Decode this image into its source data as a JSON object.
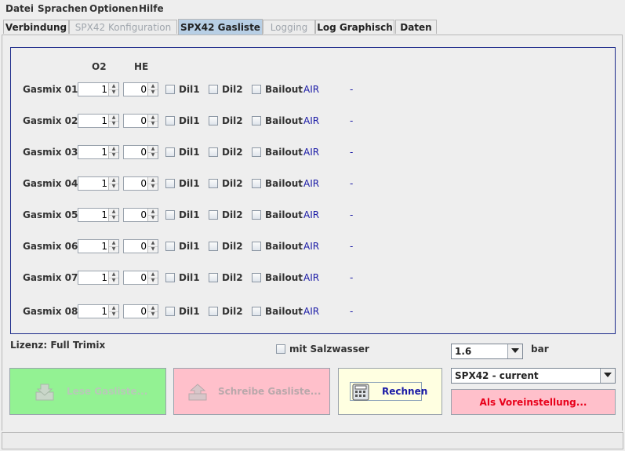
{
  "menu": [
    "Datei",
    "Sprachen",
    "Optionen",
    "Hilfe"
  ],
  "tabs": [
    {
      "label": "Verbindung",
      "state": "normal"
    },
    {
      "label": "SPX42 Konfiguration",
      "state": "disabled"
    },
    {
      "label": "SPX42 Gasliste",
      "state": "active"
    },
    {
      "label": "Logging",
      "state": "disabled"
    },
    {
      "label": "Log Graphisch",
      "state": "normal"
    },
    {
      "label": "Daten",
      "state": "normal"
    }
  ],
  "gaslist": {
    "col_o2": "O2",
    "col_he": "HE",
    "dil1_label": "Dil1",
    "dil2_label": "Dil2",
    "bailout_label": "Bailout",
    "rows": [
      {
        "label": "Gasmix 01",
        "o2": "1",
        "he": "0",
        "dil1": false,
        "dil2": false,
        "bailout": false,
        "gas": "AIR",
        "info": "-"
      },
      {
        "label": "Gasmix 02",
        "o2": "1",
        "he": "0",
        "dil1": false,
        "dil2": false,
        "bailout": false,
        "gas": "AIR",
        "info": "-"
      },
      {
        "label": "Gasmix 03",
        "o2": "1",
        "he": "0",
        "dil1": false,
        "dil2": false,
        "bailout": false,
        "gas": "AIR",
        "info": "-"
      },
      {
        "label": "Gasmix 04",
        "o2": "1",
        "he": "0",
        "dil1": false,
        "dil2": false,
        "bailout": false,
        "gas": "AIR",
        "info": "-"
      },
      {
        "label": "Gasmix 05",
        "o2": "1",
        "he": "0",
        "dil1": false,
        "dil2": false,
        "bailout": false,
        "gas": "AIR",
        "info": "-"
      },
      {
        "label": "Gasmix 06",
        "o2": "1",
        "he": "0",
        "dil1": false,
        "dil2": false,
        "bailout": false,
        "gas": "AIR",
        "info": "-"
      },
      {
        "label": "Gasmix 07",
        "o2": "1",
        "he": "0",
        "dil1": false,
        "dil2": false,
        "bailout": false,
        "gas": "AIR",
        "info": "-"
      },
      {
        "label": "Gasmix 08",
        "o2": "1",
        "he": "0",
        "dil1": false,
        "dil2": false,
        "bailout": false,
        "gas": "AIR",
        "info": "-"
      }
    ]
  },
  "license": "Lizenz: Full Trimix",
  "salzwasser_label": "mit Salzwasser",
  "ppo2_select": {
    "value": "1.6"
  },
  "unit_label": "bar",
  "device_select": {
    "value": "SPX42 - current"
  },
  "buttons": {
    "lese": "Lese Gasliste...",
    "schreibe": "Schreibe Gasliste...",
    "rechnen": "Rechnen",
    "voreinstellung": "Als Voreinstellung..."
  },
  "icons": {
    "lese": "download-tray-icon",
    "schreibe": "upload-tray-icon",
    "rechnen": "calculator-icon"
  },
  "colors": {
    "active_tab": "#b8cfe5",
    "panel_border": "#1c2a8a",
    "gas_text": "#1a1aa6",
    "lese_bg": "#93f293",
    "schreibe_bg": "#ffc0cb",
    "rechnen_bg": "#ffffe1",
    "vor_text": "#e8001a"
  }
}
